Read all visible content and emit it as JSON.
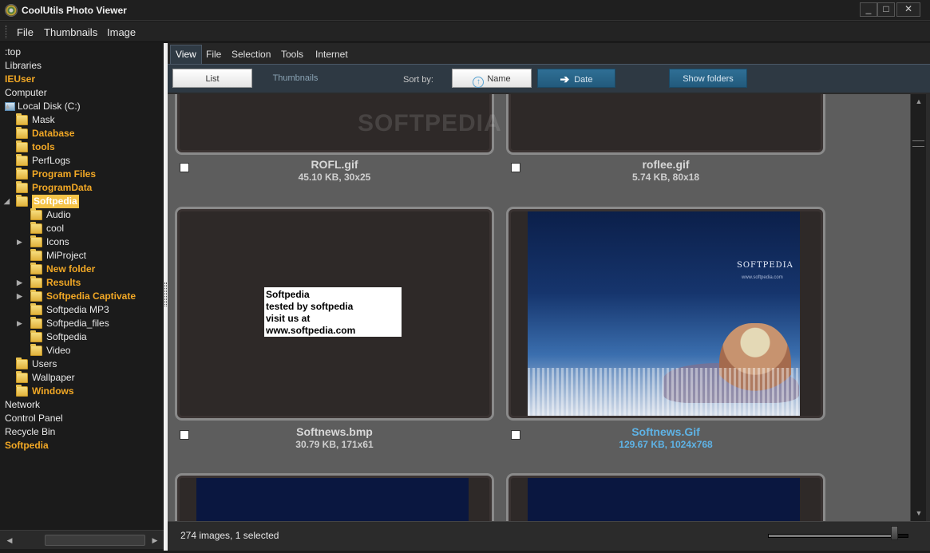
{
  "window": {
    "title": "CoolUtils Photo Viewer",
    "minimize": "_",
    "maximize": "□",
    "close": "✕"
  },
  "menu": {
    "items": [
      "File",
      "Thumbnails",
      "Image"
    ]
  },
  "tree": {
    "items": [
      {
        "label": ":top",
        "bold": false
      },
      {
        "label": "Libraries",
        "bold": false
      },
      {
        "label": "IEUser",
        "bold": true
      },
      {
        "label": "Computer",
        "bold": false
      },
      {
        "label": "Local Disk (C:)",
        "bold": false
      },
      {
        "label": "Mask",
        "bold": false
      },
      {
        "label": "Database",
        "bold": true
      },
      {
        "label": "tools",
        "bold": true
      },
      {
        "label": "PerfLogs",
        "bold": false
      },
      {
        "label": "Program Files",
        "bold": true
      },
      {
        "label": "ProgramData",
        "bold": true
      },
      {
        "label": "Softpedia",
        "bold": true,
        "selected": true
      },
      {
        "label": "Audio",
        "bold": false
      },
      {
        "label": "cool",
        "bold": false
      },
      {
        "label": "Icons",
        "bold": false
      },
      {
        "label": "MiProject",
        "bold": false
      },
      {
        "label": "New folder",
        "bold": true
      },
      {
        "label": "Results",
        "bold": true
      },
      {
        "label": "Softpedia Captivate",
        "bold": true
      },
      {
        "label": "Softpedia MP3",
        "bold": false
      },
      {
        "label": "Softpedia_files",
        "bold": false
      },
      {
        "label": "Softpedia",
        "bold": false
      },
      {
        "label": "Video",
        "bold": false
      },
      {
        "label": "Users",
        "bold": false
      },
      {
        "label": "Wallpaper",
        "bold": false
      },
      {
        "label": "Windows",
        "bold": true
      },
      {
        "label": "Network",
        "bold": false
      },
      {
        "label": "Control Panel",
        "bold": false
      },
      {
        "label": "Recycle Bin",
        "bold": false
      },
      {
        "label": "Softpedia",
        "bold": true
      }
    ]
  },
  "ribbon": {
    "tabs": [
      "View",
      "File",
      "Selection",
      "Tools",
      "Internet"
    ],
    "active_tab": "View",
    "list_label": "List",
    "thumbnails_label": "Thumbnails",
    "sort_by_label": "Sort by:",
    "sort_name_label": "Name",
    "sort_date_label": "Date",
    "show_folders_label": "Show folders"
  },
  "watermark": "SOFTPEDIA",
  "thumbnails": [
    {
      "name": "ROFL.gif",
      "info": "45.10 KB, 30x25",
      "selected": false,
      "checked": false
    },
    {
      "name": "roflee.gif",
      "info": "5.74 KB, 80x18",
      "selected": false,
      "checked": false
    },
    {
      "name": "Softnews.bmp",
      "info": "30.79 KB, 171x61",
      "selected": false,
      "checked": false,
      "image_text": [
        "Softpedia",
        "tested by softpedia",
        "visit us at www.softpedia.com"
      ]
    },
    {
      "name": "Softnews.Gif",
      "info": "129.67 KB, 1024x768",
      "selected": true,
      "checked": false,
      "image_text": [
        "SOFTPEDIA",
        "www.softpedia.com"
      ]
    },
    {
      "name": "",
      "info": "",
      "selected": false,
      "checked": false
    },
    {
      "name": "",
      "info": "",
      "selected": false,
      "checked": false
    }
  ],
  "status": {
    "text": "274 images, 1 selected",
    "zoom_fraction": 0.9
  },
  "colors": {
    "accent_bold_folder": "#f2a825",
    "selected_text": "#5eb3e6",
    "ribbon_bg": "#2e3943",
    "thumb_area_bg": "#5d5d5d"
  }
}
